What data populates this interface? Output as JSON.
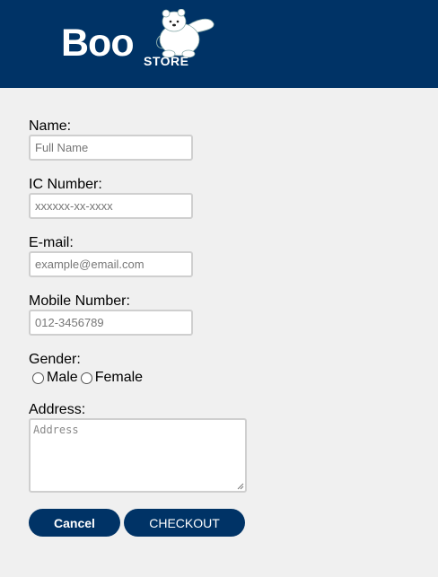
{
  "header": {
    "logo_text": "Boo",
    "logo_sub": "STORE",
    "brand_color": "#003366"
  },
  "form": {
    "name": {
      "label": "Name:",
      "placeholder": "Full Name",
      "value": ""
    },
    "ic": {
      "label": "IC Number:",
      "placeholder": "xxxxxx-xx-xxxx",
      "value": ""
    },
    "email": {
      "label": "E-mail:",
      "placeholder": "example@email.com",
      "value": ""
    },
    "mobile": {
      "label": "Mobile Number:",
      "placeholder": "012-3456789",
      "value": ""
    },
    "gender": {
      "label": "Gender:",
      "options": [
        "Male",
        "Female"
      ],
      "selected": ""
    },
    "address": {
      "label": "Address:",
      "placeholder": "Address",
      "value": ""
    }
  },
  "buttons": {
    "cancel": "Cancel",
    "checkout": "CHECKOUT"
  },
  "icons": {
    "logo": "bear-mascot-icon",
    "resize": "resize-grip-icon"
  }
}
